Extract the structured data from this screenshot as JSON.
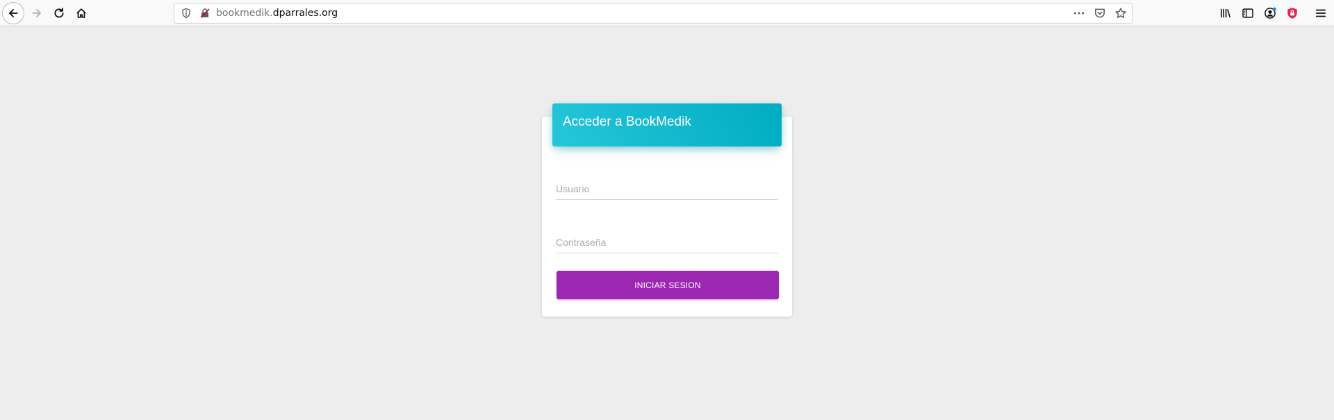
{
  "browser": {
    "url_prefix": "bookmedik.",
    "url_domain": "dparrales.org",
    "icons": {
      "back": "arrow-left-icon",
      "forward": "arrow-right-icon",
      "reload": "reload-icon",
      "home": "home-icon",
      "tracking": "shield-icon",
      "connection": "insecure-lock-icon",
      "page_actions": "more-icon",
      "pocket": "pocket-icon",
      "bookmark": "star-icon",
      "library": "library-icon",
      "sidebar": "sidebar-icon",
      "account": "account-icon",
      "extension": "extension-shield-icon",
      "menu": "hamburger-menu-icon"
    }
  },
  "login": {
    "title": "Acceder a BookMedik",
    "username_placeholder": "Usuario",
    "password_placeholder": "Contraseña",
    "submit_label": "INICIAR SESION"
  },
  "colors": {
    "header_gradient_start": "#26c6da",
    "header_gradient_end": "#00acc1",
    "button": "#9c27b0",
    "page_background": "#ededed"
  }
}
